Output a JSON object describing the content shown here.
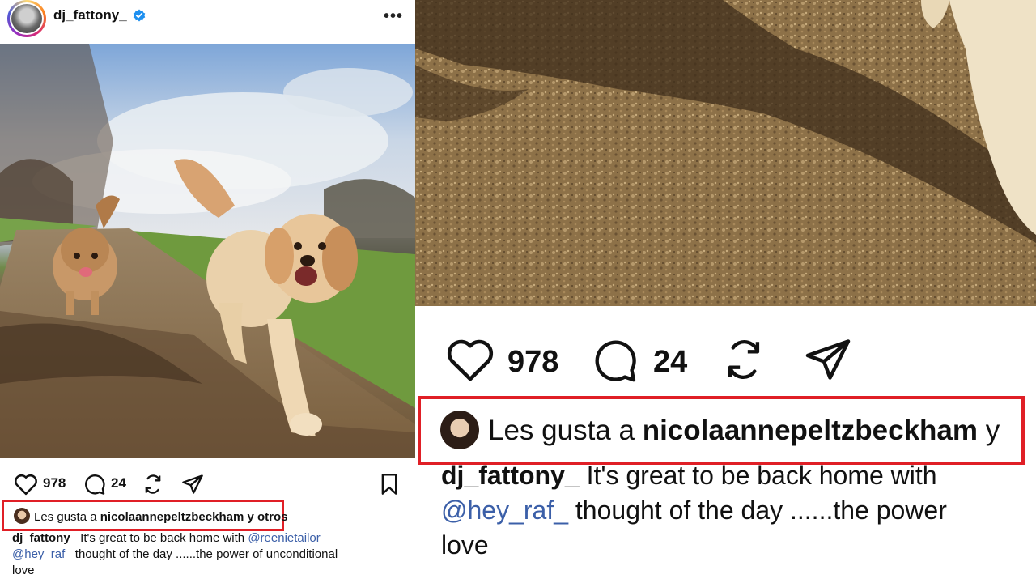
{
  "post": {
    "username": "dj_fattony_",
    "likes_count": "978",
    "comments_count": "24",
    "liked_by_prefix": "Les gusta a ",
    "liked_by_user": "nicolaannepeltzbeckham",
    "liked_by_suffix": " y otros",
    "caption_line1_text": " It's great to be back home with ",
    "caption_mention1": "@reenietailor",
    "caption_mention2": "@hey_raf_",
    "caption_line2_text": " thought of the day ......the power of unconditional",
    "caption_line3_text": "love"
  },
  "zoom": {
    "likes_count": "978",
    "comments_count": "24",
    "liked_by_prefix": "Les gusta a ",
    "liked_by_user": "nicolaannepeltzbeckham",
    "liked_by_suffix": " y",
    "caption_user": "dj_fattony_",
    "caption_line1_text": " It's great to be back home with",
    "caption_mention": "@hey_raf_",
    "caption_line2_text": " thought of the day ......the power",
    "caption_line3_text": "love"
  },
  "icons": {
    "heart": "heart-icon",
    "comment": "comment-icon",
    "repost": "repost-icon",
    "share": "share-icon",
    "bookmark": "bookmark-icon",
    "more": "more-options-icon",
    "verified": "verified-badge-icon"
  },
  "colors": {
    "highlight_box": "#e01f26",
    "mention": "#3b5fa8",
    "verified": "#1e90f0"
  }
}
